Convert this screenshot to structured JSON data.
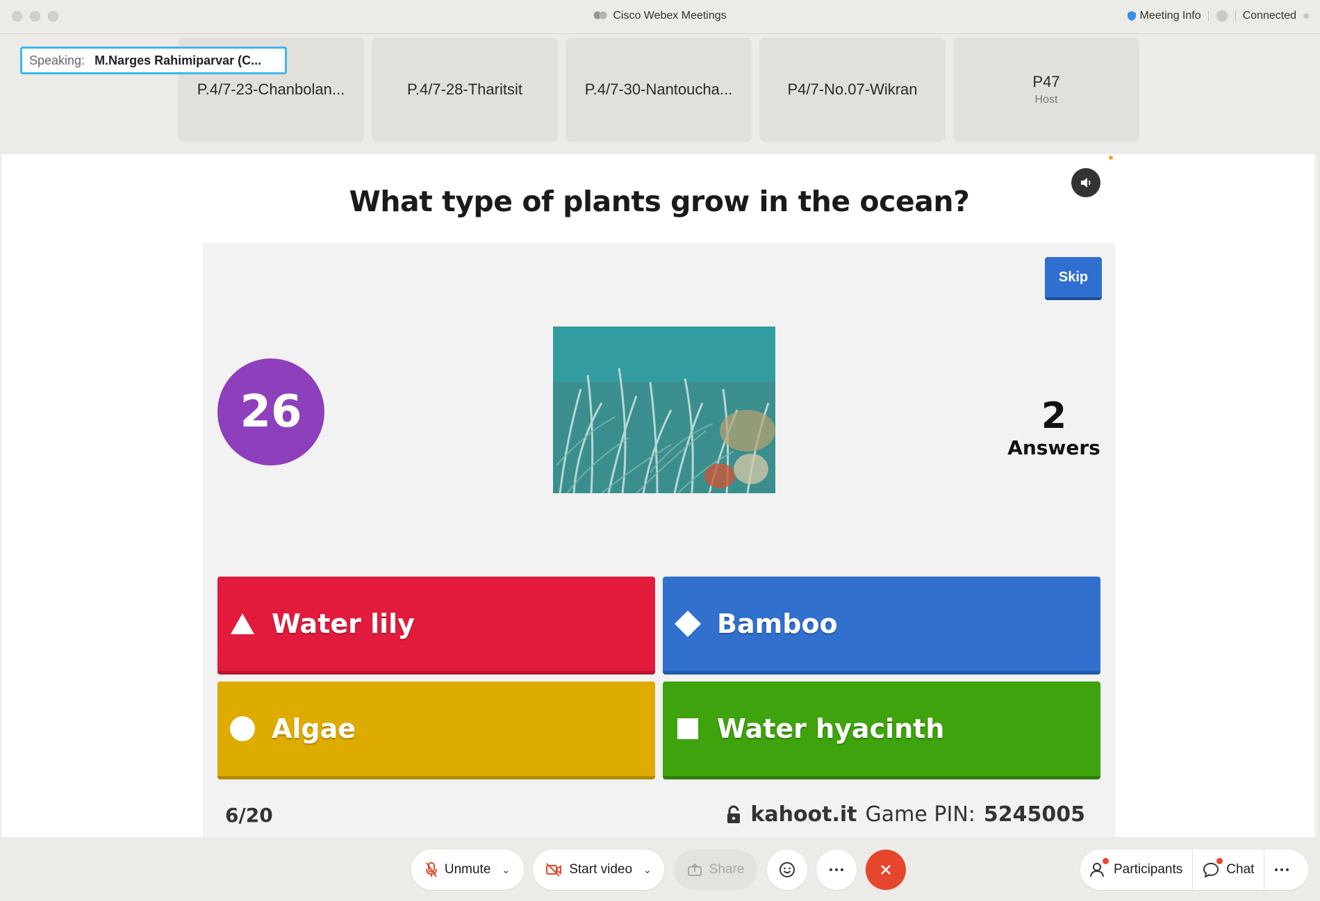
{
  "window": {
    "title": "Cisco Webex Meetings",
    "meeting_info": "Meeting Info",
    "status": "Connected"
  },
  "speaking": {
    "label": "Speaking:",
    "name": "M.Narges Rahimiparvar (C..."
  },
  "participants": [
    {
      "name": "P.4/7-23-Chanbolan...",
      "role": ""
    },
    {
      "name": "P.4/7-28-Tharitsit",
      "role": ""
    },
    {
      "name": "P.4/7-30-Nantoucha...",
      "role": ""
    },
    {
      "name": "P4/7-No.07-Wikran",
      "role": ""
    },
    {
      "name": "P47",
      "role": "Host"
    }
  ],
  "quiz": {
    "question": "What type of plants grow in the ocean?",
    "timer": "26",
    "skip_label": "Skip",
    "answers_count": "2",
    "answers_label": "Answers",
    "options": [
      {
        "text": "Water lily",
        "shape": "triangle-icon",
        "color": "#e21b3c"
      },
      {
        "text": "Bamboo",
        "shape": "diamond-icon",
        "color": "#3170cd"
      },
      {
        "text": "Algae",
        "shape": "circle-icon",
        "color": "#deac00"
      },
      {
        "text": "Water hyacinth",
        "shape": "square-icon",
        "color": "#3ea30d"
      }
    ],
    "progress": "6/20",
    "site": "kahoot.it",
    "pin_label": "Game PIN:",
    "pin": "5245005"
  },
  "controls": {
    "unmute": "Unmute",
    "start_video": "Start video",
    "share": "Share",
    "participants": "Participants",
    "chat": "Chat"
  },
  "colors": {
    "end_call": "#e5462c",
    "timer_purple": "#8e3fbc",
    "skip_blue": "#2f6fd0",
    "speaking_border": "#3fb6e6"
  }
}
